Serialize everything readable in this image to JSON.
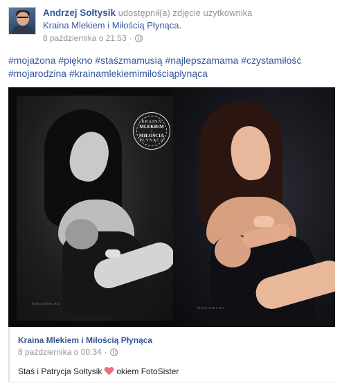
{
  "post": {
    "author": "Andrzej Sołtysik",
    "action": "udostępnił(a) zdjęcie użytkownika",
    "shared_from": "Kraina Mlekiem i Miłością Płynąca.",
    "timestamp": "8 października o 21:53",
    "privacy_icon": "globe-icon",
    "hashtags": [
      "#mojażona",
      "#piękno",
      "#staśzmamusią",
      "#najlepszamama",
      "#czystamiłość",
      "#mojarodzina",
      "#krainamlekiemimiłościąpłynąca"
    ]
  },
  "photo": {
    "seal": {
      "line1": "KRAINA",
      "line2": "MLEKIEM",
      "line3": "I",
      "line4": "MIŁOŚCIĄ",
      "line5": "PŁYNĄCA"
    },
    "watermark_left": "fotosister.eu",
    "watermark_right": "fotosister.eu"
  },
  "shared_post": {
    "page_name": "Kraina Mlekiem i Miłością Płynąca",
    "timestamp": "8 października o 00:34",
    "privacy_icon": "globe-icon",
    "caption_before": "Staś i Patrycja Sołtysik",
    "heart_icon": "heart-icon",
    "caption_after": "okiem FotoSister"
  },
  "colors": {
    "link": "#365899",
    "meta": "#90949c",
    "heart": "#e8707c"
  }
}
